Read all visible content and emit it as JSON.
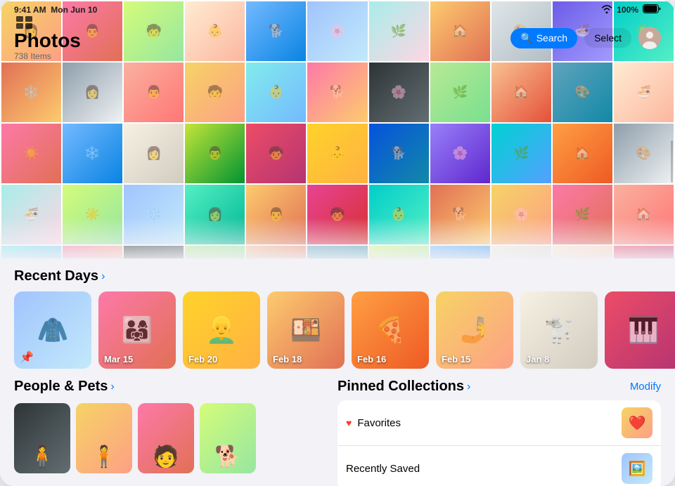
{
  "statusBar": {
    "time": "9:41 AM",
    "date": "Mon Jun 10",
    "wifi": "wifi",
    "battery": "100%"
  },
  "header": {
    "title": "Photos",
    "subtitle": "738 Items",
    "gridToggleLabel": "grid-view",
    "searchLabel": "Search",
    "selectLabel": "Select"
  },
  "photoGrid": {
    "colors": [
      "c2",
      "c7",
      "c4",
      "c5",
      "c8",
      "c6",
      "c3",
      "c10",
      "c11",
      "c13",
      "c14",
      "c15",
      "c1",
      "c16",
      "c2",
      "c17",
      "c18",
      "c19",
      "c20",
      "c21",
      "c22",
      "c5",
      "c7",
      "c8",
      "c23",
      "c24",
      "c25",
      "c26",
      "c27",
      "c28",
      "c29",
      "c30",
      "c1",
      "c3",
      "c4",
      "c6",
      "c9",
      "c10",
      "c12",
      "c14",
      "c15",
      "c2",
      "c7",
      "c16",
      "c17",
      "c18",
      "c19",
      "c20",
      "c21",
      "c22",
      "c4",
      "c8",
      "c23",
      "c5",
      "c25",
      "c26",
      "c1",
      "c3",
      "c6",
      "c13",
      "c27",
      "c28",
      "c29",
      "c30",
      "c2",
      "c7",
      "c4",
      "c5",
      "c8",
      "c6",
      "c3",
      "c10",
      "c11",
      "c13",
      "c14",
      "c15",
      "c1",
      "c16",
      "c2",
      "c17",
      "c18",
      "c19",
      "c20",
      "c21",
      "c22",
      "c5",
      "c7",
      "c8"
    ]
  },
  "recentDays": {
    "sectionTitle": "Recent Days",
    "arrowSymbol": "›",
    "cards": [
      {
        "id": "pinned",
        "label": "",
        "color": "c6",
        "hasPin": true
      },
      {
        "id": "mar15",
        "label": "Mar 15",
        "color": "c7"
      },
      {
        "id": "feb20",
        "label": "Feb 20",
        "color": "c26"
      },
      {
        "id": "feb18",
        "label": "Feb 18",
        "color": "c10"
      },
      {
        "id": "feb16",
        "label": "Feb 16",
        "color": "c30"
      },
      {
        "id": "feb15",
        "label": "Feb 15",
        "color": "c2"
      },
      {
        "id": "jan8",
        "label": "Jan 8",
        "color": "c23"
      },
      {
        "id": "more",
        "label": "",
        "color": "c25"
      }
    ]
  },
  "peoplePets": {
    "sectionTitle": "People & Pets",
    "arrowSymbol": "›",
    "thumbs": [
      {
        "color": "c19",
        "emoji": "🧍"
      },
      {
        "color": "c2",
        "emoji": "🧍"
      },
      {
        "color": "c7",
        "emoji": "🧑"
      },
      {
        "color": "c4",
        "emoji": "🐕"
      }
    ]
  },
  "pinnedCollections": {
    "sectionTitle": "Pinned Collections",
    "arrowSymbol": "›",
    "modifyLabel": "Modify",
    "items": [
      {
        "label": "Favorites",
        "icon": "♥",
        "color": "c2"
      },
      {
        "label": "Recently Saved",
        "icon": "",
        "color": "c6"
      }
    ]
  }
}
